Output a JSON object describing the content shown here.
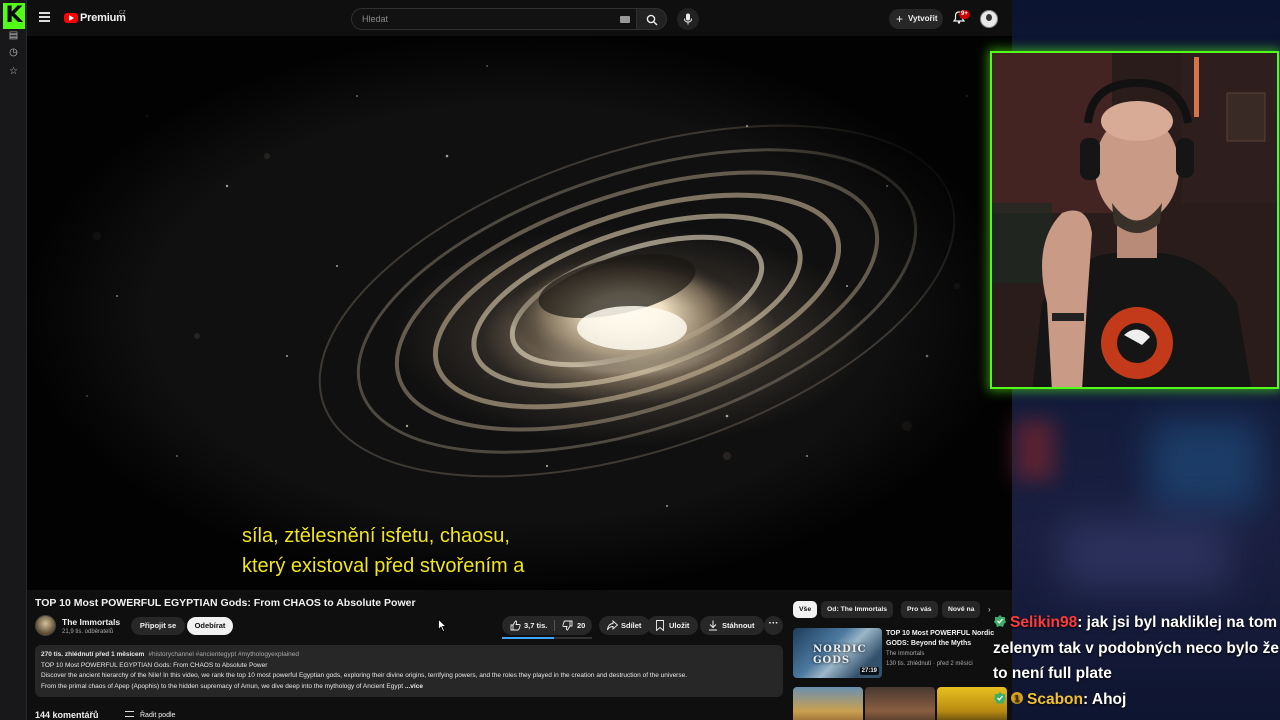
{
  "header": {
    "brand": "Premium",
    "region": "CZ",
    "search_placeholder": "Hledat",
    "create_label": "Vytvořit",
    "notifications_count": "9+"
  },
  "video": {
    "subtitle_line1": "síla, ztělesnění isfetu, chaosu,",
    "subtitle_line2": "který existoval před stvořením a",
    "title": "TOP 10 Most POWERFUL EGYPTIAN Gods: From CHAOS to Absolute Power"
  },
  "channel": {
    "name": "The Immortals",
    "subscribers": "21,9 tis. odběratelů",
    "join_label": "Připojit se",
    "unsubscribe_label": "Odebírat"
  },
  "actions": {
    "likes": "3,7 tis.",
    "dislikes": "20",
    "share": "Sdílet",
    "save": "Uložit",
    "download": "Stáhnout",
    "more": "···"
  },
  "description": {
    "meta": "270 tis. zhlédnutí  před 1 měsícem",
    "tags": "#historychannel #ancientegypt #mythologyexplained",
    "line1": "TOP 10 Most POWERFUL EGYPTIAN Gods: From CHAOS to Absolute Power",
    "line2": "Discover the ancient hierarchy of the Nile! In this video, we rank the top 10 most powerful Egyptian gods, exploring their divine origins, terrifying powers, and the roles they played in the creation and destruction of the universe.",
    "line3": "From the primal chaos of Apep (Apophis) to the hidden supremacy of Amun, we dive deep into the mythology of Ancient Egypt",
    "more": "...více"
  },
  "comments": {
    "count": "144 komentářů",
    "sort_label": "Řadit podle"
  },
  "chips": [
    "Vše",
    "Od: The Immortals",
    "Pro vás",
    "Nově na"
  ],
  "related": [
    {
      "title": "TOP 10 Most POWERFUL Nordic GODS: Beyond the Myths",
      "thumb_text": "NORDIC GODS",
      "channel": "The Immortals",
      "meta": "130 tis. zhlédnutí · před 2 měsíci",
      "duration": "27:19"
    }
  ],
  "chat": [
    {
      "user": "Selikin98",
      "message": ": jak jsi byl nakliklej na tom zelenym tak v podobných neco bylo že to není full plate"
    },
    {
      "user": "Scabon",
      "message": ": Ahoj"
    }
  ],
  "colors": {
    "kick_green": "#53fc18",
    "yt_red": "#ff0000",
    "subtitle_yellow": "#f2e61a",
    "accent_blue": "#3ea6ff"
  },
  "icons": [
    "kick-logo-icon",
    "menu-icon",
    "youtube-logo-icon",
    "keyboard-icon",
    "search-icon",
    "mic-icon",
    "plus-icon",
    "bell-icon",
    "avatar-icon",
    "like-icon",
    "dislike-icon",
    "share-icon",
    "save-icon",
    "download-icon",
    "chevron-right-icon",
    "sort-icon"
  ]
}
